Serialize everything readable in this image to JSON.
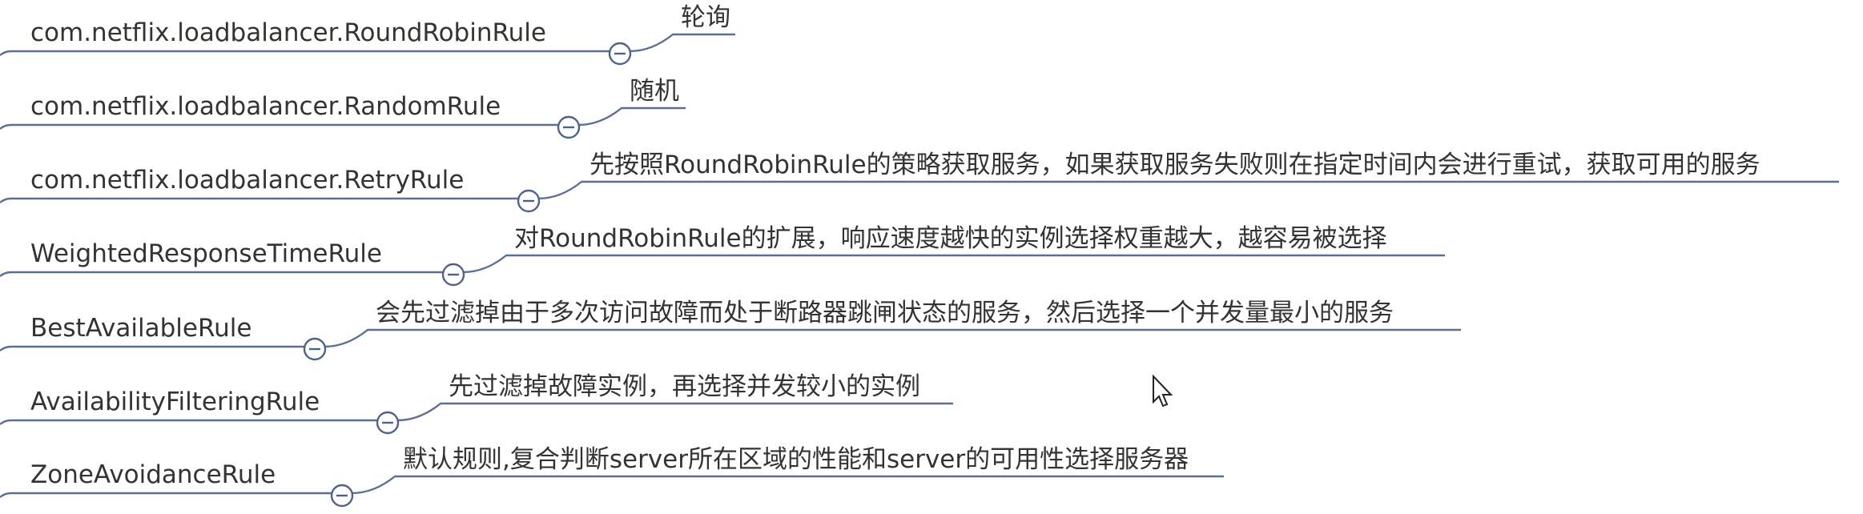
{
  "branches": [
    {
      "name": "com.netflix.loadbalancer.RoundRobinRule",
      "description": "轮询"
    },
    {
      "name": "com.netflix.loadbalancer.RandomRule",
      "description": "随机"
    },
    {
      "name": "com.netflix.loadbalancer.RetryRule",
      "description": "先按照RoundRobinRule的策略获取服务，如果获取服务失败则在指定时间内会进行重试，获取可用的服务"
    },
    {
      "name": "WeightedResponseTimeRule",
      "description": "对RoundRobinRule的扩展，响应速度越快的实例选择权重越大，越容易被选择"
    },
    {
      "name": "BestAvailableRule",
      "description": "会先过滤掉由于多次访问故障而处于断路器跳闸状态的服务，然后选择一个并发量最小的服务"
    },
    {
      "name": "AvailabilityFilteringRule",
      "description": "先过滤掉故障实例，再选择并发较小的实例"
    },
    {
      "name": "ZoneAvoidanceRule",
      "description": "默认规则,复合判断server所在区域的性能和server的可用性选择服务器"
    }
  ],
  "icons": {
    "collapse": "minus-circle-icon",
    "cursor": "mouse-pointer-icon"
  },
  "colors": {
    "line": "#5b6f94",
    "text": "#333333"
  }
}
